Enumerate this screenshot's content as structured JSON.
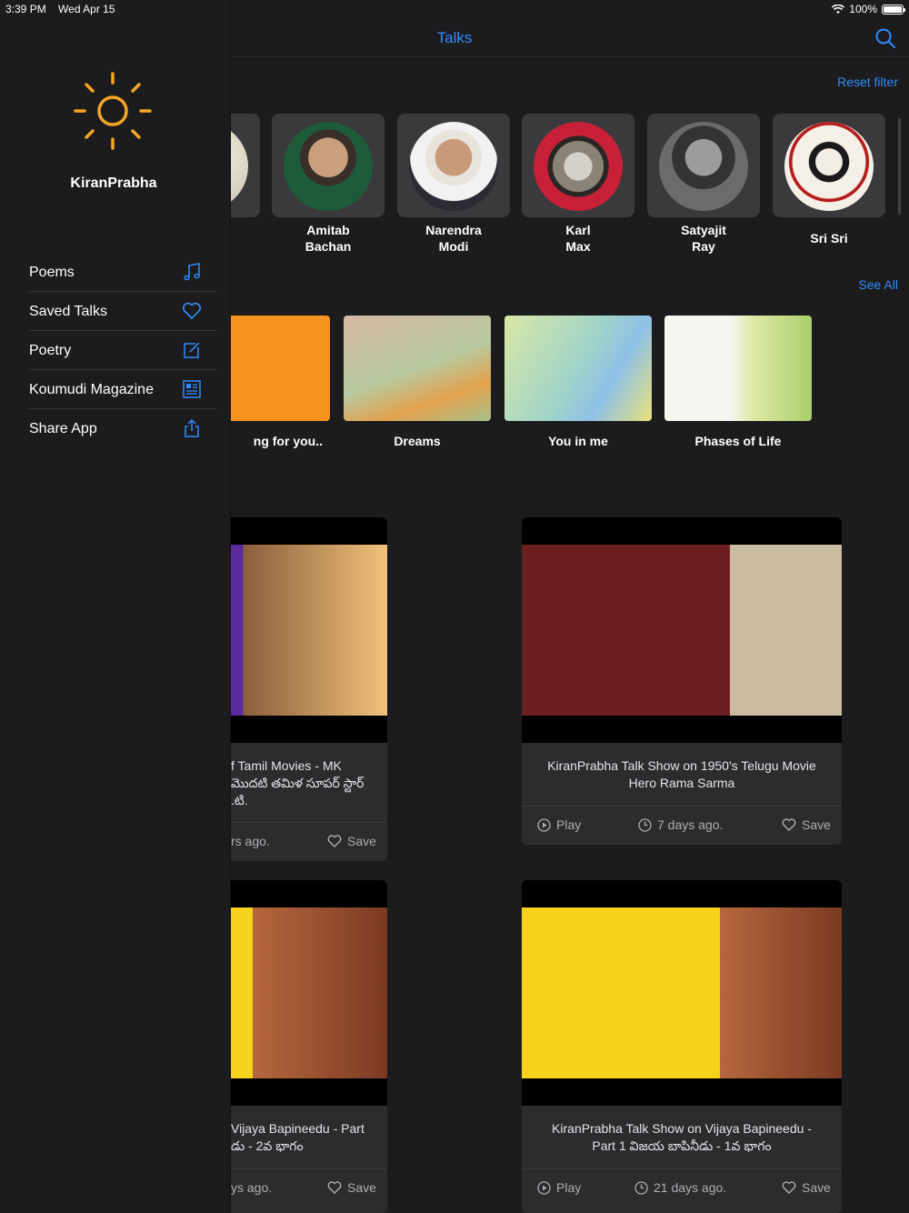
{
  "status_bar": {
    "time": "3:39 PM",
    "date": "Wed Apr 15",
    "battery": "100%"
  },
  "nav": {
    "title": "Talks"
  },
  "filters": {
    "reset_label": "Reset filter"
  },
  "speakers": [
    {
      "name": "Amitab\nBachan"
    },
    {
      "name": "Narendra\nModi"
    },
    {
      "name": "Karl\nMax"
    },
    {
      "name": "Satyajit\nRay"
    },
    {
      "name": "Sri Sri"
    }
  ],
  "collections": {
    "see_all_label": "See All",
    "items": [
      {
        "title": "ng for you.."
      },
      {
        "title": "Dreams"
      },
      {
        "title": "You in me"
      },
      {
        "title": "Phases of Life"
      }
    ]
  },
  "talks": [
    {
      "title": "f Tamil Movies - MK\nమొదటి తమిళ సూపర్ స్టార్\n.టి.",
      "time": "rs ago.",
      "save": "Save"
    },
    {
      "title": "KiranPrabha Talk Show on 1950's Telugu Movie Hero Rama Sarma",
      "play": "Play",
      "time": "7 days ago.",
      "save": "Save"
    },
    {
      "title": "Vijaya Bapineedu - Part\nడు - 2వ భాగం",
      "time": "ys ago.",
      "save": "Save"
    },
    {
      "title": "KiranPrabha Talk Show on Vijaya Bapineedu - Part 1 విజయ బాపినీడు - 1వ భాగం",
      "play": "Play",
      "time": "21 days ago.",
      "save": "Save"
    }
  ],
  "drawer": {
    "brand": "KiranPrabha",
    "menu": [
      {
        "label": "Poems",
        "icon": "music-note-icon"
      },
      {
        "label": "Saved Talks",
        "icon": "heart-icon"
      },
      {
        "label": "Poetry",
        "icon": "compose-icon"
      },
      {
        "label": "Koumudi Magazine",
        "icon": "newspaper-icon"
      },
      {
        "label": "Share App",
        "icon": "share-icon"
      }
    ]
  },
  "colors": {
    "accent": "#2f8cff",
    "sun": "#f5a623",
    "background": "#1c1c1e",
    "card": "#2c2c2e"
  }
}
